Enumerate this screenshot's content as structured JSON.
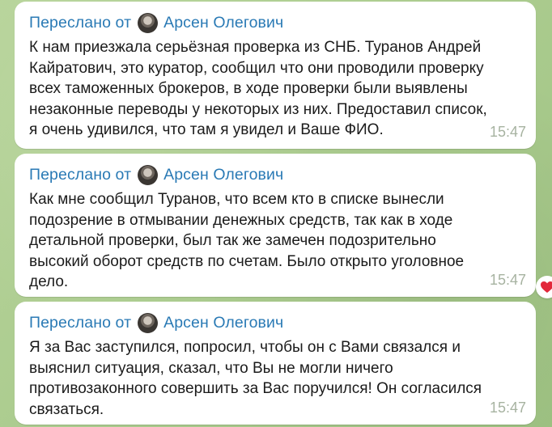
{
  "messages": [
    {
      "forwarded_prefix": "Переслано от",
      "sender": "Арсен Олегович",
      "text": "К нам приезжала серьёзная проверка из СНБ. Туранов Андрей Кайратович, это куратор, сообщил что они проводили проверку всех таможенных брокеров, в ходе проверки были выявлены незаконные переводы у некоторых из них. Предоставил список, я очень удивился, что там я увидел и Ваше ФИО.",
      "time": "15:47"
    },
    {
      "forwarded_prefix": "Переслано от",
      "sender": "Арсен Олегович",
      "text": "Как мне сообщил Туранов, что всем кто в списке вынесли подозрение в отмывании денежных средств, так как в ходе детальной проверки, был так же замечен подозрительно высокий оборот средств по счетам. Было открыто уголовное дело.",
      "time": "15:47",
      "reaction": "heart-icon"
    },
    {
      "forwarded_prefix": "Переслано от",
      "sender": "Арсен Олегович",
      "text": "Я за Вас заступился, попросил, чтобы он с Вами связался и выяснил ситуация, сказал, что Вы не могли ничего противозаконного совершить за Вас поручился! Он согласился связаться.",
      "time": "15:47"
    }
  ],
  "colors": {
    "background": "#a9c98e",
    "bubble": "#ffffff",
    "sender": "#2a7ab5",
    "text": "#1b1b1b",
    "time": "#a7b3a1",
    "reaction": "#e2283b"
  }
}
